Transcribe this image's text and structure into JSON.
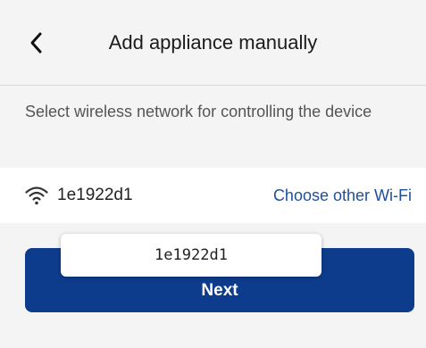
{
  "header": {
    "title": "Add appliance manually",
    "back_icon": "chevron-left-icon"
  },
  "instruction": {
    "text": "Select wireless network for controlling the device"
  },
  "wifi": {
    "icon": "wifi-icon",
    "ssid": "1e1922d1",
    "choose_other_label": "Choose other Wi-Fi"
  },
  "actions": {
    "next_label": "Next"
  },
  "tooltip": {
    "text": "1e1922d1"
  },
  "colors": {
    "primary_button": "#0d3c8c",
    "link": "#1f4f98",
    "background": "#f4f4f4"
  }
}
